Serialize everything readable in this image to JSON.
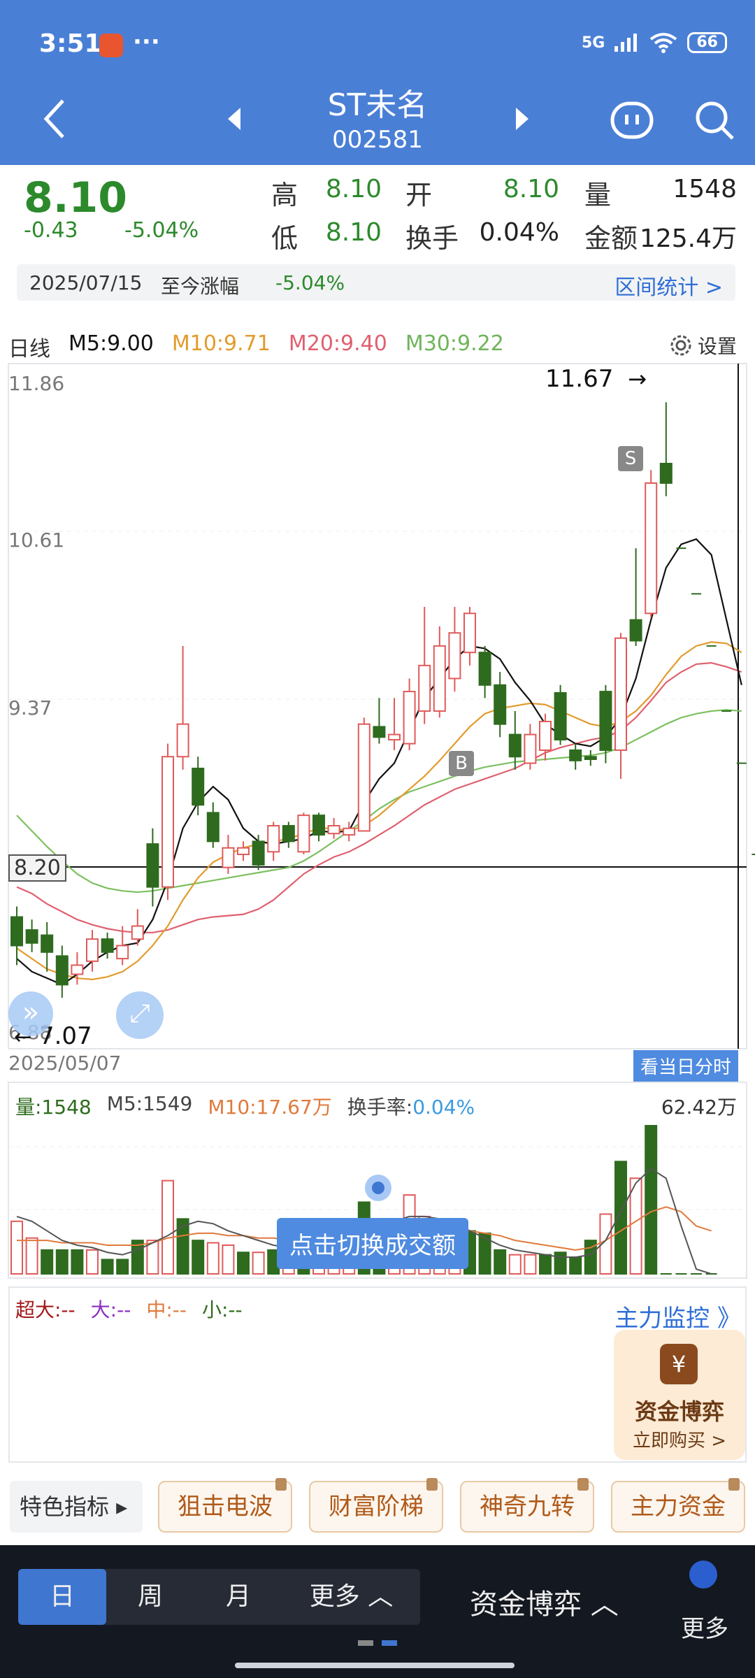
{
  "status": {
    "time": "3:51",
    "dots": "···",
    "network": "5G",
    "battery": "66"
  },
  "header": {
    "name": "ST未名",
    "code": "002581"
  },
  "quote": {
    "price": "8.10",
    "change": "-0.43",
    "change_pct": "-5.04%",
    "high_label": "高",
    "high": "8.10",
    "open_label": "开",
    "open": "8.10",
    "volume_label": "量",
    "volume": "1548",
    "low_label": "低",
    "low": "8.10",
    "turnover_label": "换手",
    "turnover": "0.04%",
    "amount_label": "金额",
    "amount": "125.4万"
  },
  "range": {
    "date": "2025/07/15",
    "label": "至今涨幅",
    "value": "-5.04%",
    "link": "区间统计 >"
  },
  "ma": {
    "period": "日线",
    "m5": "M5:9.00",
    "m10": "M10:9.71",
    "m20": "M20:9.40",
    "m30": "M30:9.22",
    "settings": "设置"
  },
  "axis": {
    "top": "11.86",
    "mid1": "10.61",
    "mid2": "9.37",
    "current": "8.20",
    "bottom": "6.88",
    "start_date": "2025/05/07",
    "max_label": "11.67",
    "min_label": "7.07"
  },
  "markers": {
    "s": "S",
    "b": "B"
  },
  "hint_button": "看当日分时",
  "volume_header": {
    "vol": "量:1548",
    "m5": "M5:1549",
    "m10": "M10:17.67万",
    "turnover_label": "换手率:",
    "turnover": "0.04%",
    "max": "62.42万"
  },
  "tooltip": "点击切换成交额",
  "flow": {
    "super": "超大:--",
    "big": "大:--",
    "mid": "中:--",
    "small": "小:--",
    "link": "主力监控 》"
  },
  "promo": {
    "title": "资金博弈",
    "action": "立即购买 >"
  },
  "indicators": {
    "first": "特色指标 ▸",
    "items": [
      "狙击电波",
      "财富阶梯",
      "神奇九转",
      "主力资金"
    ]
  },
  "bottom_nav": {
    "periods": [
      "日",
      "周",
      "月",
      "更多 ︿"
    ],
    "fund": "资金博弈 ︿",
    "more": "更多"
  },
  "colors": {
    "up": "#e05a5a",
    "down": "#2e6b1f",
    "m5": "#111111",
    "m10": "#e29b2c",
    "m20": "#e06070",
    "m30": "#7cc060",
    "accent": "#4a7fd6"
  },
  "candles": [
    {
      "o": 7.72,
      "c": 7.5,
      "h": 7.8,
      "l": 7.35
    },
    {
      "o": 7.62,
      "c": 7.52,
      "h": 7.7,
      "l": 7.45
    },
    {
      "o": 7.58,
      "c": 7.45,
      "h": 7.68,
      "l": 7.3
    },
    {
      "o": 7.42,
      "c": 7.2,
      "h": 7.5,
      "l": 7.1
    },
    {
      "o": 7.28,
      "c": 7.35,
      "h": 7.45,
      "l": 7.2
    },
    {
      "o": 7.38,
      "c": 7.55,
      "h": 7.62,
      "l": 7.3
    },
    {
      "o": 7.55,
      "c": 7.45,
      "h": 7.6,
      "l": 7.4
    },
    {
      "o": 7.4,
      "c": 7.5,
      "h": 7.65,
      "l": 7.35
    },
    {
      "o": 7.55,
      "c": 7.65,
      "h": 7.78,
      "l": 7.5
    },
    {
      "o": 8.28,
      "c": 7.95,
      "h": 8.4,
      "l": 7.8
    },
    {
      "o": 7.95,
      "c": 8.95,
      "h": 9.05,
      "l": 7.85
    },
    {
      "o": 8.95,
      "c": 9.2,
      "h": 9.8,
      "l": 8.85
    },
    {
      "o": 8.86,
      "c": 8.58,
      "h": 8.95,
      "l": 8.5
    },
    {
      "o": 8.52,
      "c": 8.3,
      "h": 8.6,
      "l": 8.25
    },
    {
      "o": 8.1,
      "c": 8.25,
      "h": 8.35,
      "l": 8.05
    },
    {
      "o": 8.2,
      "c": 8.25,
      "h": 8.3,
      "l": 8.15
    },
    {
      "o": 8.3,
      "c": 8.12,
      "h": 8.35,
      "l": 8.08
    },
    {
      "o": 8.22,
      "c": 8.42,
      "h": 8.45,
      "l": 8.15
    },
    {
      "o": 8.42,
      "c": 8.3,
      "h": 8.45,
      "l": 8.25
    },
    {
      "o": 8.22,
      "c": 8.5,
      "h": 8.52,
      "l": 8.2
    },
    {
      "o": 8.5,
      "c": 8.35,
      "h": 8.52,
      "l": 8.3
    },
    {
      "o": 8.36,
      "c": 8.42,
      "h": 8.48,
      "l": 8.32
    },
    {
      "o": 8.35,
      "c": 8.4,
      "h": 8.45,
      "l": 8.3
    },
    {
      "o": 8.38,
      "c": 9.2,
      "h": 9.25,
      "l": 8.38
    },
    {
      "o": 9.18,
      "c": 9.1,
      "h": 9.4,
      "l": 9.05
    },
    {
      "o": 9.08,
      "c": 9.12,
      "h": 9.4,
      "l": 9.0
    },
    {
      "o": 9.05,
      "c": 9.45,
      "h": 9.55,
      "l": 9.0
    },
    {
      "o": 9.3,
      "c": 9.65,
      "h": 10.1,
      "l": 9.2
    },
    {
      "o": 9.3,
      "c": 9.8,
      "h": 9.95,
      "l": 9.25
    },
    {
      "o": 9.55,
      "c": 9.9,
      "h": 10.1,
      "l": 9.45
    },
    {
      "o": 9.75,
      "c": 10.05,
      "h": 10.1,
      "l": 9.65
    },
    {
      "o": 9.75,
      "c": 9.5,
      "h": 9.8,
      "l": 9.4
    },
    {
      "o": 9.5,
      "c": 9.2,
      "h": 9.6,
      "l": 9.1
    },
    {
      "o": 9.12,
      "c": 8.95,
      "h": 9.3,
      "l": 8.85
    },
    {
      "o": 8.9,
      "c": 9.12,
      "h": 9.2,
      "l": 8.85
    },
    {
      "o": 9.0,
      "c": 9.22,
      "h": 9.28,
      "l": 8.92
    },
    {
      "o": 9.44,
      "c": 9.08,
      "h": 9.5,
      "l": 9.04
    },
    {
      "o": 9.0,
      "c": 8.92,
      "h": 9.05,
      "l": 8.85
    },
    {
      "o": 8.95,
      "c": 8.93,
      "h": 9.0,
      "l": 8.88
    },
    {
      "o": 9.45,
      "c": 9.0,
      "h": 9.5,
      "l": 8.9
    },
    {
      "o": 9.0,
      "c": 9.86,
      "h": 9.9,
      "l": 8.78
    },
    {
      "o": 10.0,
      "c": 9.84,
      "h": 10.55,
      "l": 9.8
    },
    {
      "o": 10.05,
      "c": 11.05,
      "h": 11.15,
      "l": 10.02
    },
    {
      "o": 11.2,
      "c": 11.05,
      "h": 11.67,
      "l": 10.95
    }
  ],
  "ma_lines": {
    "m5": [
      7.4,
      7.3,
      7.25,
      7.2,
      7.28,
      7.38,
      7.45,
      7.5,
      7.52,
      7.7,
      8.0,
      8.4,
      8.6,
      8.72,
      8.62,
      8.4,
      8.3,
      8.28,
      8.3,
      8.32,
      8.38,
      8.37,
      8.38,
      8.6,
      8.78,
      8.9,
      9.15,
      9.4,
      9.55,
      9.7,
      9.8,
      9.78,
      9.7,
      9.52,
      9.38,
      9.2,
      9.12,
      9.05,
      9.03,
      9.1,
      9.25,
      9.55,
      10.0,
      10.4,
      10.58,
      10.62,
      10.5,
      10.0,
      9.5
    ],
    "m10": [
      7.48,
      7.4,
      7.32,
      7.28,
      7.25,
      7.24,
      7.26,
      7.3,
      7.38,
      7.5,
      7.65,
      7.85,
      8.02,
      8.14,
      8.2,
      8.25,
      8.28,
      8.3,
      8.32,
      8.36,
      8.4,
      8.4,
      8.38,
      8.42,
      8.5,
      8.6,
      8.7,
      8.8,
      8.92,
      9.05,
      9.18,
      9.28,
      9.32,
      9.34,
      9.36,
      9.35,
      9.3,
      9.25,
      9.2,
      9.18,
      9.22,
      9.3,
      9.42,
      9.58,
      9.72,
      9.8,
      9.83,
      9.82,
      9.75
    ],
    "m20": [
      7.95,
      7.9,
      7.82,
      7.76,
      7.7,
      7.66,
      7.63,
      7.61,
      7.6,
      7.6,
      7.62,
      7.66,
      7.7,
      7.72,
      7.73,
      7.74,
      7.78,
      7.85,
      7.95,
      8.05,
      8.12,
      8.18,
      8.22,
      8.28,
      8.35,
      8.42,
      8.5,
      8.58,
      8.64,
      8.7,
      8.74,
      8.78,
      8.82,
      8.86,
      8.92,
      8.98,
      9.02,
      9.05,
      9.08,
      9.1,
      9.15,
      9.25,
      9.38,
      9.52,
      9.6,
      9.66,
      9.67,
      9.64,
      9.6
    ],
    "m30": [
      8.5,
      8.38,
      8.26,
      8.15,
      8.05,
      7.98,
      7.94,
      7.92,
      7.91,
      7.92,
      7.94,
      7.96,
      7.98,
      8.0,
      8.02,
      8.04,
      8.06,
      8.08,
      8.1,
      8.15,
      8.22,
      8.3,
      8.38,
      8.46,
      8.55,
      8.62,
      8.68,
      8.72,
      8.76,
      8.8,
      8.84,
      8.87,
      8.89,
      8.91,
      8.92,
      8.93,
      8.94,
      8.95,
      8.96,
      8.98,
      9.02,
      9.08,
      9.14,
      9.2,
      9.25,
      9.28,
      9.3,
      9.31,
      9.3
    ]
  },
  "volumes": [
    {
      "v": 22,
      "up": true
    },
    {
      "v": 15,
      "up": true
    },
    {
      "v": 10,
      "up": false
    },
    {
      "v": 10,
      "up": false
    },
    {
      "v": 10,
      "up": false
    },
    {
      "v": 10,
      "up": true
    },
    {
      "v": 6,
      "up": false
    },
    {
      "v": 6,
      "up": false
    },
    {
      "v": 14,
      "up": false
    },
    {
      "v": 14,
      "up": true
    },
    {
      "v": 39,
      "up": true
    },
    {
      "v": 23,
      "up": false
    },
    {
      "v": 14,
      "up": false
    },
    {
      "v": 13,
      "up": true
    },
    {
      "v": 12,
      "up": true
    },
    {
      "v": 9,
      "up": false
    },
    {
      "v": 9,
      "up": true
    },
    {
      "v": 10,
      "up": false
    },
    {
      "v": 12,
      "up": true
    },
    {
      "v": 10,
      "up": false
    },
    {
      "v": 11,
      "up": true
    },
    {
      "v": 14,
      "up": true
    },
    {
      "v": 17,
      "up": true
    },
    {
      "v": 30,
      "up": false
    },
    {
      "v": 18,
      "up": false
    },
    {
      "v": 12,
      "up": true
    },
    {
      "v": 33,
      "up": true
    },
    {
      "v": 24,
      "up": true
    },
    {
      "v": 20,
      "up": true
    },
    {
      "v": 22,
      "up": true
    },
    {
      "v": 18,
      "up": false
    },
    {
      "v": 17,
      "up": false
    },
    {
      "v": 10,
      "up": false
    },
    {
      "v": 8,
      "up": true
    },
    {
      "v": 8,
      "up": true
    },
    {
      "v": 8,
      "up": false
    },
    {
      "v": 9,
      "up": false
    },
    {
      "v": 7,
      "up": false
    },
    {
      "v": 14,
      "up": false
    },
    {
      "v": 25,
      "up": true
    },
    {
      "v": 47,
      "up": false
    },
    {
      "v": 40,
      "up": true
    },
    {
      "v": 62,
      "up": false
    }
  ],
  "vol_ma": {
    "m5": [
      24,
      22,
      18,
      14,
      12,
      11,
      9,
      8,
      10,
      13,
      16,
      20,
      22,
      21,
      18,
      16,
      14,
      12,
      11,
      11,
      11,
      12,
      14,
      18,
      20,
      22,
      24,
      24,
      23,
      21,
      18,
      15,
      12,
      10,
      9,
      8,
      7,
      7,
      8,
      14,
      26,
      38,
      44,
      40,
      20,
      2,
      0
    ],
    "m10": [
      14,
      14,
      14,
      13,
      13,
      13,
      12,
      12,
      12,
      13,
      15,
      16,
      17,
      17,
      16,
      16,
      15,
      15,
      14,
      14,
      14,
      15,
      16,
      17,
      18,
      19,
      20,
      20,
      20,
      19,
      18,
      17,
      16,
      14,
      13,
      12,
      11,
      10,
      11,
      14,
      18,
      22,
      26,
      28,
      26,
      20,
      18
    ]
  }
}
